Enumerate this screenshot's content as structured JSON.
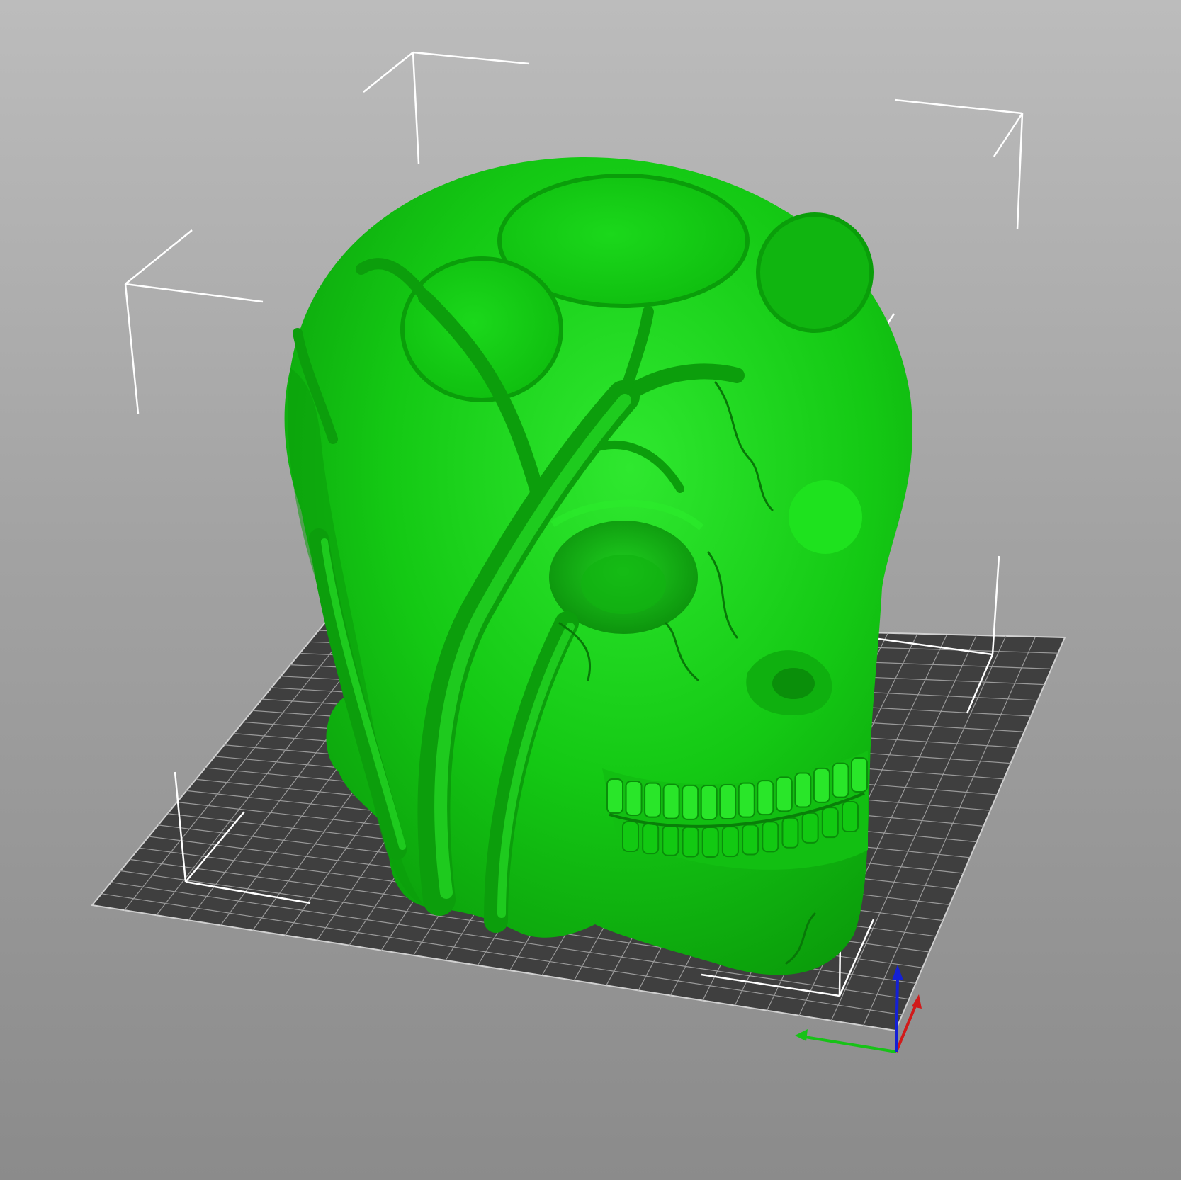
{
  "viewport": {
    "background_top": "#bcbcbc",
    "background_bottom": "#8b8b8b"
  },
  "bed": {
    "plate_color": "#3f3f3f",
    "grid_line_color": "#9a9a9a",
    "edge_color": "#d0d0d0"
  },
  "model": {
    "color": "#12c912",
    "highlight_color": "#29e629",
    "shadow_color": "#0a8e0a"
  },
  "bounding_box": {
    "line_color": "#ffffff"
  },
  "axes": {
    "x_color": "#d11a1a",
    "y_color": "#17c217",
    "z_color": "#1420d6"
  }
}
